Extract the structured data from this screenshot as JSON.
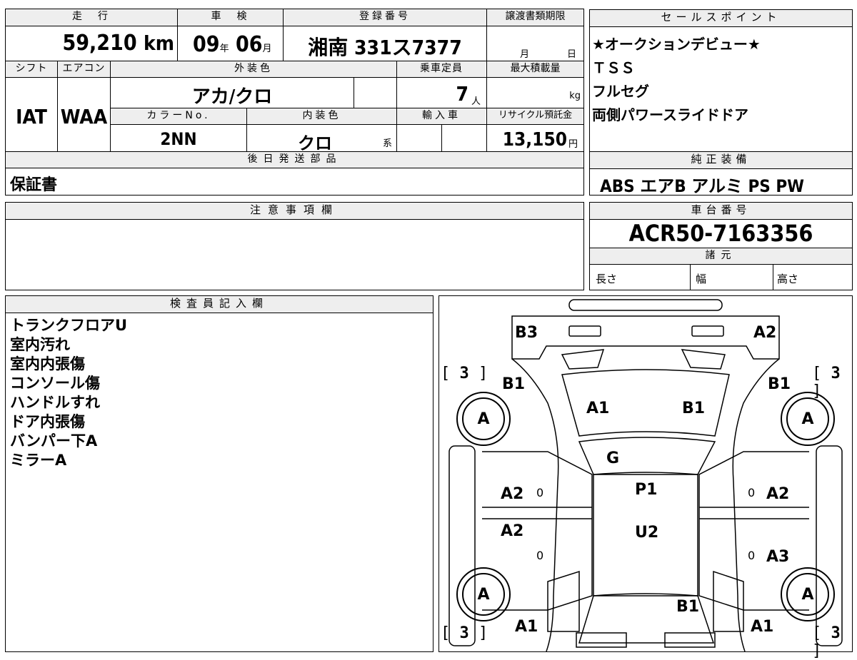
{
  "summary": {
    "mileage_label": "走　行",
    "mileage_value": "59,210",
    "mileage_unit": "km",
    "inspection_label": "車　検",
    "inspection_year": "09",
    "inspection_year_unit": "年",
    "inspection_month": "06",
    "inspection_month_unit": "月",
    "registration_label": "登録番号",
    "registration_value": "湘南 331ス7377",
    "transfer_label": "譲渡書類期限",
    "transfer_month_unit": "月",
    "transfer_day_unit": "日",
    "shift_label": "シフト",
    "shift_value": "IAT",
    "aircon_label": "エアコン",
    "aircon_value": "WAA",
    "exterior_label": "外装色",
    "exterior_value": "アカ/クロ",
    "capacity_label": "乗車定員",
    "capacity_value": "7",
    "capacity_unit": "人",
    "maxload_label": "最大積載量",
    "maxload_unit": "kg",
    "color_no_label": "カラーNo.",
    "color_no_value": "2NN",
    "interior_label": "内装色",
    "interior_value": "クロ",
    "interior_unit": "系",
    "import_label": "輸入車",
    "recycle_label": "リサイクル預託金",
    "recycle_value": "13,150",
    "recycle_unit": "円",
    "later_parts_label": "後日発送部品",
    "later_parts_value": "保証書"
  },
  "sales_points": {
    "title": "セールスポイント",
    "items": [
      "★オークションデビュー★",
      "ＴＳＳ",
      "フルセグ",
      "両側パワースライドドア"
    ]
  },
  "equipment": {
    "title": "純正装備",
    "value": "ABS エアB アルミ PS PW"
  },
  "notes": {
    "title": "注意事項欄"
  },
  "chassis": {
    "title": "車台番号",
    "value": "ACR50-7163356",
    "specs_title": "諸元",
    "length_label": "長さ",
    "width_label": "幅",
    "height_label": "高さ"
  },
  "inspector": {
    "title": "検査員記入欄",
    "lines": [
      "トランクフロアU",
      "室内汚れ",
      "室内内張傷",
      "コンソール傷",
      "ハンドルすれ",
      "ドア内張傷",
      "バンパー下A",
      "ミラーA"
    ]
  },
  "diagram": {
    "labels": {
      "rear_left": "B3",
      "rear_right": "A2",
      "rear_quarter_left": "B1",
      "rear_quarter_right": "B1",
      "rear_glass_left": "A1",
      "rear_glass_right": "B1",
      "roof_front": "G",
      "roof_p": "P1",
      "roof_u": "U2",
      "door_rl": "A2",
      "door_rr": "A2",
      "door_fl": "A2",
      "door_fr": "A3",
      "hood": "B1",
      "front_left": "A1",
      "front_right": "A1",
      "zero": "0"
    },
    "tires": {
      "rear_left": "A",
      "rear_right": "A",
      "front_left": "A",
      "front_right": "A"
    },
    "tread": "3",
    "bracket_open": "[",
    "bracket_close": "]"
  }
}
